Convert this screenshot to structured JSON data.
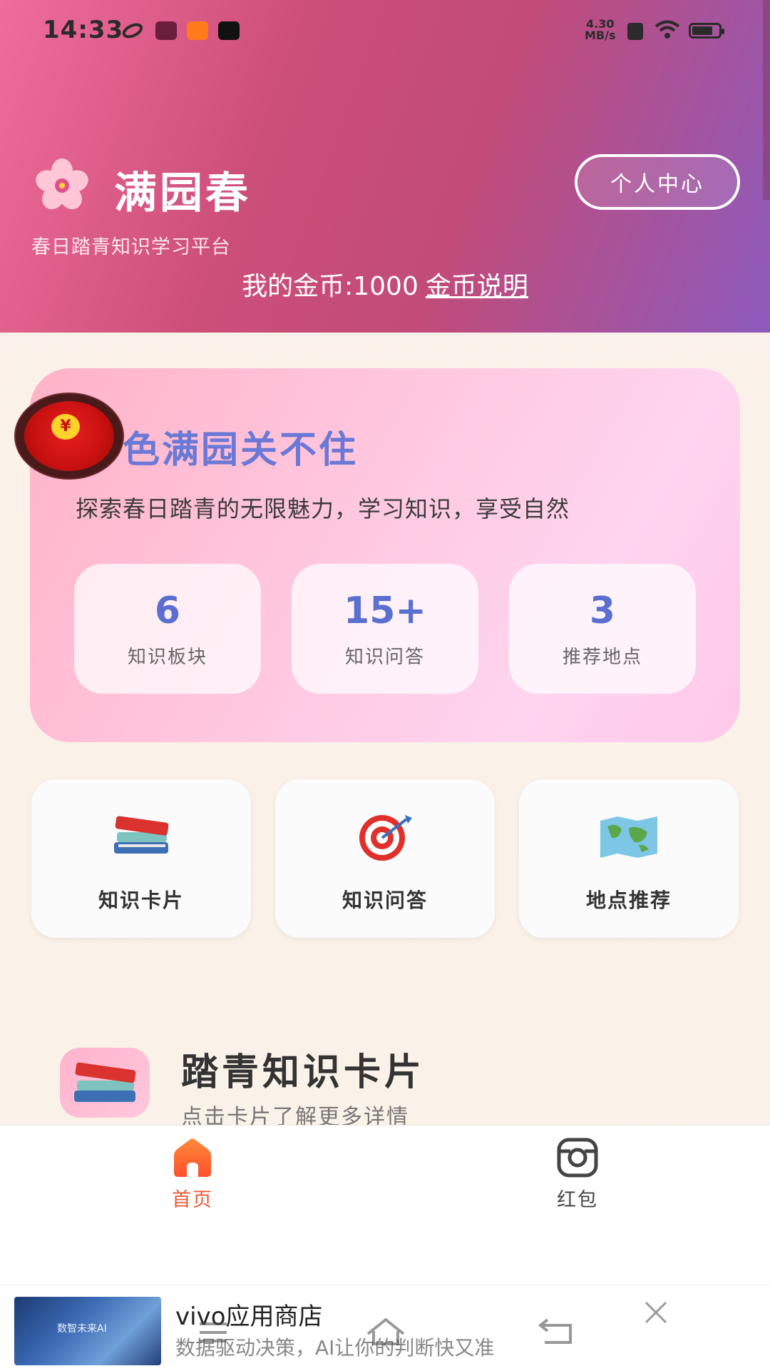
{
  "status_bar": {
    "time": "14:33",
    "speed_value": "4.30",
    "speed_unit": "MB/s",
    "icons": [
      "link-icon",
      "mail-icon",
      "app-icon",
      "tiktok-icon",
      "sim-icon",
      "wifi-icon",
      "battery-icon"
    ]
  },
  "header": {
    "app_title": "满园春",
    "subtitle": "春日踏青知识学习平台",
    "personal_center": "个人中心",
    "coins_label": "我的金币:1000",
    "coins_link": "金币说明"
  },
  "hero": {
    "title": "色满园关不住",
    "description": "探索春日踏青的无限魅力，学习知识，享受自然",
    "stats": [
      {
        "value": "6",
        "label": "知识板块"
      },
      {
        "value": "15+",
        "label": "知识问答"
      },
      {
        "value": "3",
        "label": "推荐地点"
      }
    ]
  },
  "features": [
    {
      "label": "知识卡片",
      "icon": "books-icon"
    },
    {
      "label": "知识问答",
      "icon": "target-icon"
    },
    {
      "label": "地点推荐",
      "icon": "map-icon"
    }
  ],
  "section": {
    "title": "踏青知识卡片",
    "subtitle": "点击卡片了解更多详情"
  },
  "tabbar": {
    "tabs": [
      {
        "label": "首页",
        "icon": "home-icon",
        "active": true
      },
      {
        "label": "红包",
        "icon": "camera-icon",
        "active": false
      }
    ]
  },
  "ad": {
    "title": "vivo应用商店",
    "description": "数据驱动决策，AI让你的判断快又准",
    "thumb_text": "数智未来AI"
  },
  "colors": {
    "header_start": "#f06c9b",
    "header_end": "#8d5bbd",
    "hero_title": "#6a78d6",
    "stat_value": "#5b6fd1",
    "tab_active": "#ea5a34"
  }
}
